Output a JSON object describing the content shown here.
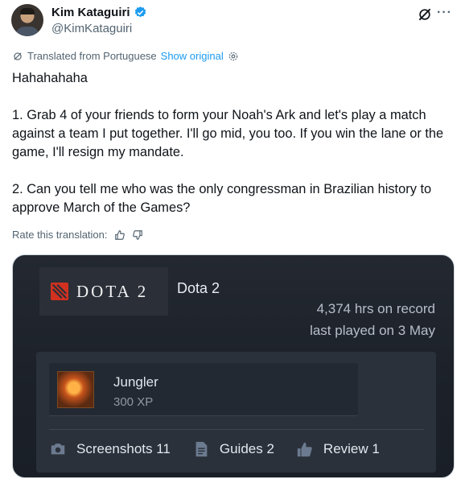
{
  "tweet": {
    "author_name": "Kim Kataguiri",
    "handle": "@KimKataguiri",
    "translated_label": "Translated from Portuguese",
    "show_original": "Show original",
    "text_line_1": "Hahahahaha",
    "text_para_2": "1. Grab 4 of your friends to form your Noah's Ark and let's play a match against a team I put together. I'll go mid, you too. If you win the lane or the game, I'll resign my mandate.",
    "text_para_3": "2. Can you tell me who was the only congressman in Brazilian history to approve March of the Games?",
    "rate_label": "Rate this translation:",
    "more_label": "···"
  },
  "card": {
    "logo_text": "DOTA 2",
    "game_title": "Dota 2",
    "hours": "4,374 hrs on record",
    "last_played": "last played on 3 May",
    "achievement": {
      "name": "Jungler",
      "xp": "300 XP"
    },
    "stats": {
      "screenshots": "Screenshots 11",
      "guides": "Guides 2",
      "review": "Review 1"
    }
  },
  "colors": {
    "link_blue": "#1d9bf0",
    "verified_blue": "#1d9bf0",
    "card_bg": "#1c2129",
    "dota_red": "#d2311f"
  },
  "icons": [
    "verified-badge-icon",
    "grok-icon",
    "more-icon",
    "translate-icon",
    "settings-gear-icon",
    "thumbs-up-icon",
    "thumbs-down-icon",
    "dota-emblem-icon",
    "camera-icon",
    "document-icon",
    "thumb-review-icon"
  ]
}
